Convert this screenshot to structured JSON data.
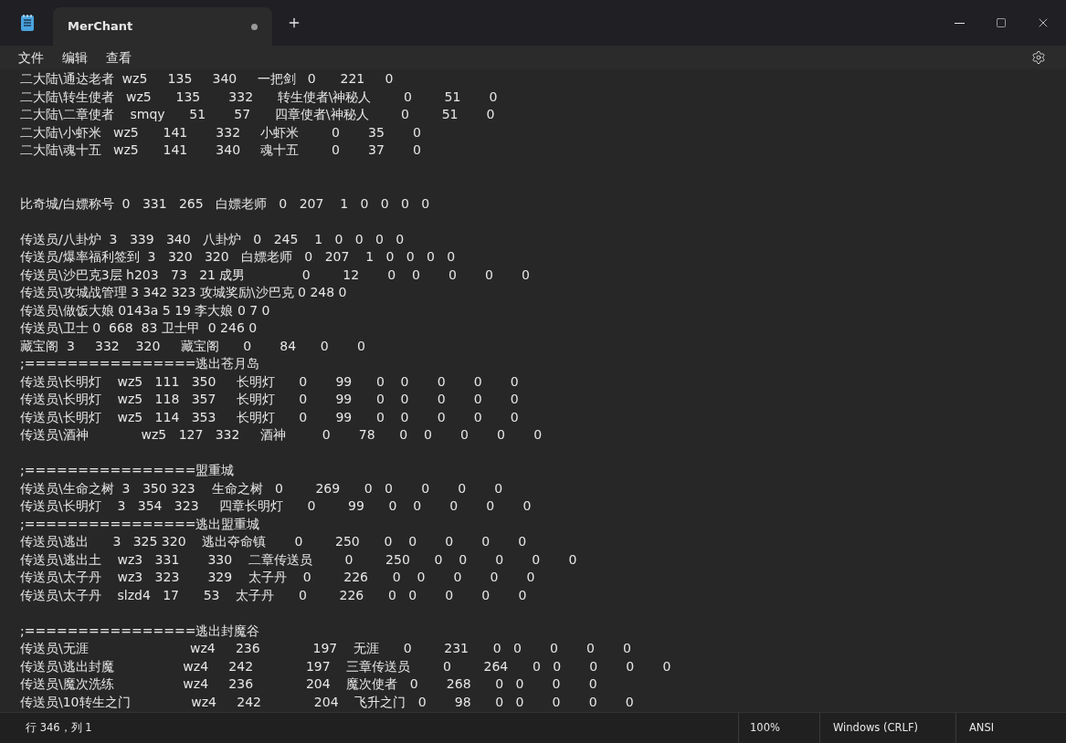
{
  "window": {
    "tab": {
      "title": "MerChant",
      "modified": true
    }
  },
  "menu": [
    {
      "label": "文件"
    },
    {
      "label": "编辑"
    },
    {
      "label": "查看"
    }
  ],
  "lines": [
    {
      "kind": "text",
      "text": "二大陆\\通达老者  wz5     135     340     一把剑   0      221     0"
    },
    {
      "kind": "text",
      "text": "二大陆\\转生使者   wz5      135       332      转生使者\\神秘人        0        51       0"
    },
    {
      "kind": "text",
      "text": "二大陆\\二章使者    smqy      51       57      四章使者\\神秘人        0        51       0"
    },
    {
      "kind": "text",
      "text": "二大陆\\小虾米   wz5      141       332     小虾米        0       35       0"
    },
    {
      "kind": "text",
      "text": "二大陆\\魂十五   wz5      141       340     魂十五        0       37       0"
    },
    {
      "kind": "blank"
    },
    {
      "kind": "blank"
    },
    {
      "kind": "text",
      "text": "比奇城/白嫖称号  0   331   265   白嫖老师   0   207    1   0   0   0   0"
    },
    {
      "kind": "blank"
    },
    {
      "kind": "text",
      "text": "传送员/八卦炉  3   339   340   八卦炉   0   245    1   0   0   0   0"
    },
    {
      "kind": "text",
      "text": "传送员/爆率福利签到  3   320   320   白嫖老师   0   207    1   0   0   0   0"
    },
    {
      "kind": "text",
      "text": "传送员\\沙巴克3层 h203   73   21 成男              0        12       0    0       0       0       0"
    },
    {
      "kind": "text",
      "text": "传送员\\攻城战管理 3 342 323 攻城奖励\\沙巴克 0 248 0"
    },
    {
      "kind": "text",
      "text": "传送员\\做饭大娘 0143a 5 19 李大娘 0 7 0"
    },
    {
      "kind": "text",
      "text": "传送员\\卫士 0  668  83 卫士甲  0 246 0"
    },
    {
      "kind": "text",
      "text": "藏宝阁  3     332    320     藏宝阁      0       84      0       0"
    },
    {
      "kind": "text",
      "text": ";================逃出苍月岛"
    },
    {
      "kind": "text",
      "text": "传送员\\长明灯    wz5   111   350     长明灯      0       99      0    0       0       0       0"
    },
    {
      "kind": "text",
      "text": "传送员\\长明灯    wz5   118   357     长明灯      0       99      0    0       0       0       0"
    },
    {
      "kind": "text",
      "text": "传送员\\长明灯    wz5   114   353     长明灯      0       99      0    0       0       0       0"
    },
    {
      "kind": "text",
      "text": "传送员\\酒神             wz5   127   332     酒神         0       78      0    0       0       0       0"
    },
    {
      "kind": "blank"
    },
    {
      "kind": "text",
      "text": ";================盟重城"
    },
    {
      "kind": "text",
      "text": "传送员\\生命之树  3   350 323    生命之树   0        269      0   0       0       0       0"
    },
    {
      "kind": "text",
      "text": "传送员\\长明灯    3   354   323     四章长明灯      0        99      0    0       0       0       0"
    },
    {
      "kind": "text",
      "text": ";================逃出盟重城"
    },
    {
      "kind": "text",
      "text": "传送员\\逃出      3   325 320    逃出夺命镇       0        250      0    0       0       0       0"
    },
    {
      "kind": "text",
      "text": "传送员\\逃出土    wz3   331       330    二章传送员        0        250      0    0       0       0       0"
    },
    {
      "kind": "text",
      "text": "传送员\\太子丹    wz3   323       329    太子丹    0        226      0    0       0       0       0"
    },
    {
      "kind": "text",
      "text": "传送员\\太子丹    slzd4   17      53    太子丹      0        226      0   0       0       0       0"
    },
    {
      "kind": "blank"
    },
    {
      "kind": "text",
      "text": ";================逃出封魔谷"
    },
    {
      "kind": "text",
      "text": "传送员\\无涯                         wz4     236             197    无涯      0        231      0   0       0       0       0"
    },
    {
      "kind": "text",
      "text": "传送员\\逃出封魔                 wz4     242             197    三章传送员        0        264      0   0       0       0       0"
    },
    {
      "kind": "text",
      "text": "传送员\\魔次洗练                 wz4     236             204    魔次使者   0       268      0   0       0       0"
    },
    {
      "kind": "text",
      "text": "传送员\\10转生之门               wz4     242             204    飞升之门   0       98      0   0       0       0       0"
    }
  ],
  "status_bar": {
    "position": "行 346，列 1",
    "zoom": "100%",
    "line_ending": "Windows (CRLF)",
    "encoding": "ANSI"
  }
}
